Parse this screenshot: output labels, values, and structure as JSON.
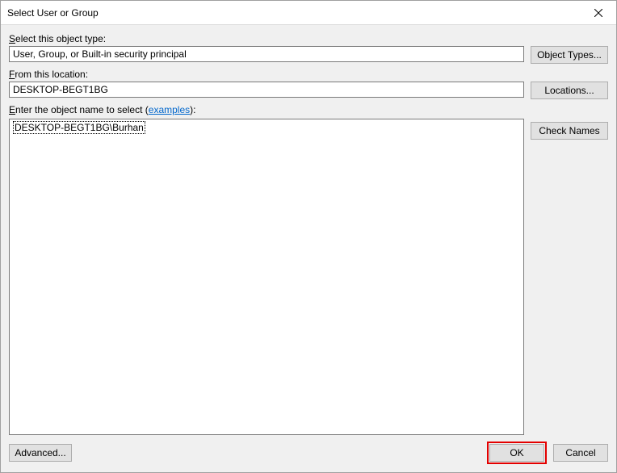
{
  "titlebar": {
    "title": "Select User or Group"
  },
  "objectType": {
    "label_prefix": "S",
    "label_rest": "elect this object type:",
    "value": "User, Group, or Built-in security principal",
    "button": "Object Types..."
  },
  "location": {
    "label_prefix": "F",
    "label_rest": "rom this location:",
    "value": "DESKTOP-BEGT1BG",
    "button": "Locations..."
  },
  "objectName": {
    "label_prefix": "E",
    "label_rest": "nter the object name to select (",
    "examples": "examples",
    "label_close": "):",
    "value": "DESKTOP-BEGT1BG\\Burhan",
    "button": "Check Names"
  },
  "buttons": {
    "advanced": "Advanced...",
    "ok": "OK",
    "cancel": "Cancel"
  }
}
